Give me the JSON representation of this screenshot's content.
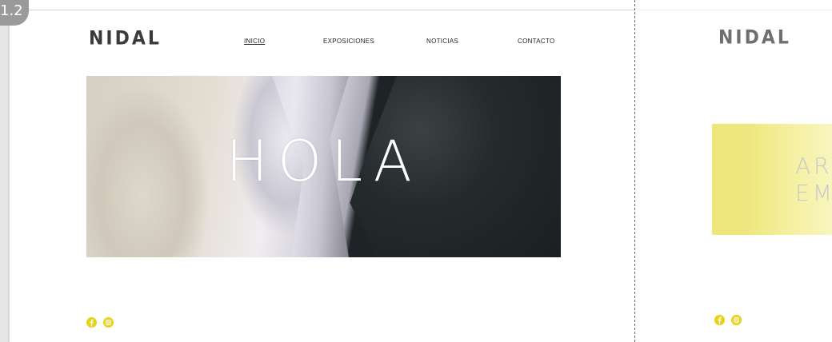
{
  "badge": {
    "label": "1.2"
  },
  "main_page": {
    "logo": "NIDAL",
    "nav": {
      "inicio": "INICIO",
      "exposiciones": "EXPOSICIONES",
      "noticias": "NOTICIAS",
      "contacto": "CONTACTO"
    },
    "hero": {
      "title": "HOLA"
    },
    "social": {
      "facebook_icon": "facebook-icon",
      "instagram_icon": "instagram-icon"
    }
  },
  "second_page": {
    "logo": "NIDAL",
    "promo": {
      "line1": "ART",
      "line2": "EM"
    },
    "social": {
      "facebook_icon": "facebook-icon",
      "instagram_icon": "instagram-icon"
    }
  },
  "colors": {
    "accent_yellow": "#e7d21a",
    "promo_yellow": "#eee77e",
    "logo": "#3a3a3a",
    "nav_text": "#222222"
  }
}
